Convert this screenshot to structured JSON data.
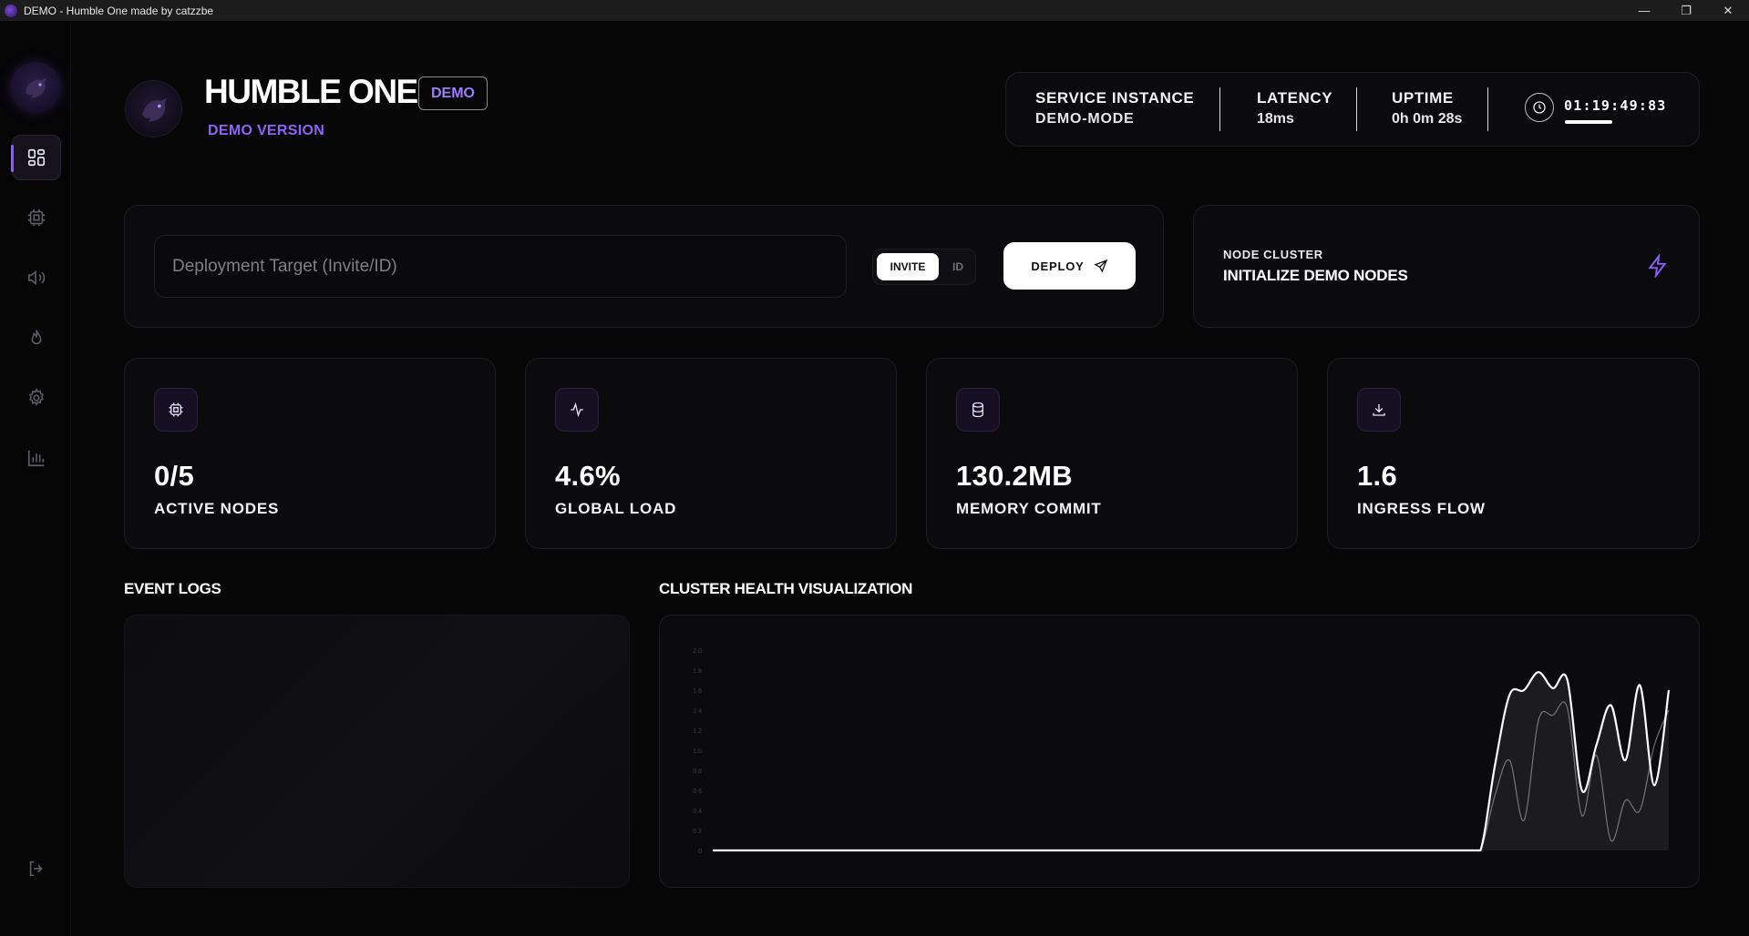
{
  "window": {
    "title": "DEMO - Humble One made by catzzbe",
    "controls": [
      "minimize",
      "restore",
      "close"
    ]
  },
  "sidebar": {
    "items": [
      {
        "name": "dashboard",
        "icon": "grid-icon",
        "active": true
      },
      {
        "name": "cpu",
        "icon": "chip-icon",
        "active": false
      },
      {
        "name": "audio",
        "icon": "speaker-icon",
        "active": false
      },
      {
        "name": "fire",
        "icon": "flame-icon",
        "active": false
      },
      {
        "name": "settings",
        "icon": "gear-icon",
        "active": false
      },
      {
        "name": "analytics",
        "icon": "bar-chart-icon",
        "active": false
      }
    ],
    "logout_icon": "logout-icon"
  },
  "header": {
    "title": "HUMBLE ONE",
    "badge": "DEMO",
    "subtitle": "DEMO VERSION"
  },
  "status": {
    "service_label": "SERVICE INSTANCE",
    "service_value": "DEMO-MODE",
    "latency_label": "LATENCY",
    "latency_value": "18ms",
    "uptime_label": "UPTIME",
    "uptime_value": "0h 0m 28s",
    "clock": "01:19:49:83"
  },
  "deploy": {
    "placeholder": "Deployment Target (Invite/ID)",
    "toggle_on": "INVITE",
    "toggle_off": "ID",
    "button": "DEPLOY"
  },
  "node_cluster": {
    "label": "NODE CLUSTER",
    "action": "INITIALIZE DEMO NODES"
  },
  "metrics": [
    {
      "icon": "chip-icon",
      "value": "0/5",
      "label": "ACTIVE NODES"
    },
    {
      "icon": "activity-icon",
      "value": "4.6%",
      "label": "GLOBAL LOAD"
    },
    {
      "icon": "database-icon",
      "value": "130.2MB",
      "label": "MEMORY COMMIT"
    },
    {
      "icon": "download-icon",
      "value": "1.6",
      "label": "INGRESS FLOW"
    }
  ],
  "sections": {
    "logs": "EVENT LOGS",
    "chart": "CLUSTER HEALTH VISUALIZATION"
  },
  "colors": {
    "accent": "#8a5cf6",
    "background": "#070708",
    "card": "#0b0b0d"
  },
  "chart_data": {
    "type": "area",
    "title": "CLUSTER HEALTH VISUALIZATION",
    "yticks": [
      "0",
      "0.2",
      "0.4",
      "0.6",
      "0.8",
      "1.0",
      "1.2",
      "1.4",
      "1.6",
      "1.8",
      "2.0"
    ],
    "ylim": [
      0,
      2.0
    ],
    "grid": false,
    "series": [
      {
        "values": [
          0,
          0,
          0,
          0,
          0,
          0,
          0,
          0,
          0,
          0,
          0,
          0,
          0,
          0,
          0,
          0,
          0,
          0,
          0,
          0,
          0,
          0,
          0,
          0,
          0,
          0,
          0,
          0,
          0,
          0,
          0,
          0,
          0,
          0,
          0,
          0,
          0,
          0,
          0,
          0,
          0,
          0,
          0,
          0,
          0,
          0,
          0,
          0,
          0,
          0,
          0,
          0,
          0,
          0,
          0.85,
          1.55,
          1.6,
          1.78,
          1.62,
          1.7,
          0.6,
          1.05,
          1.45,
          0.9,
          1.65,
          0.65,
          1.6
        ]
      },
      {
        "values": [
          0,
          0,
          0,
          0,
          0,
          0,
          0,
          0,
          0,
          0,
          0,
          0,
          0,
          0,
          0,
          0,
          0,
          0,
          0,
          0,
          0,
          0,
          0,
          0,
          0,
          0,
          0,
          0,
          0,
          0,
          0,
          0,
          0,
          0,
          0,
          0,
          0,
          0,
          0,
          0,
          0,
          0,
          0,
          0,
          0,
          0,
          0,
          0,
          0,
          0,
          0,
          0,
          0,
          0,
          0.55,
          0.9,
          0.3,
          1.3,
          1.35,
          1.42,
          0.35,
          0.95,
          0.1,
          0.5,
          0.4,
          1.05,
          1.4
        ]
      }
    ]
  }
}
